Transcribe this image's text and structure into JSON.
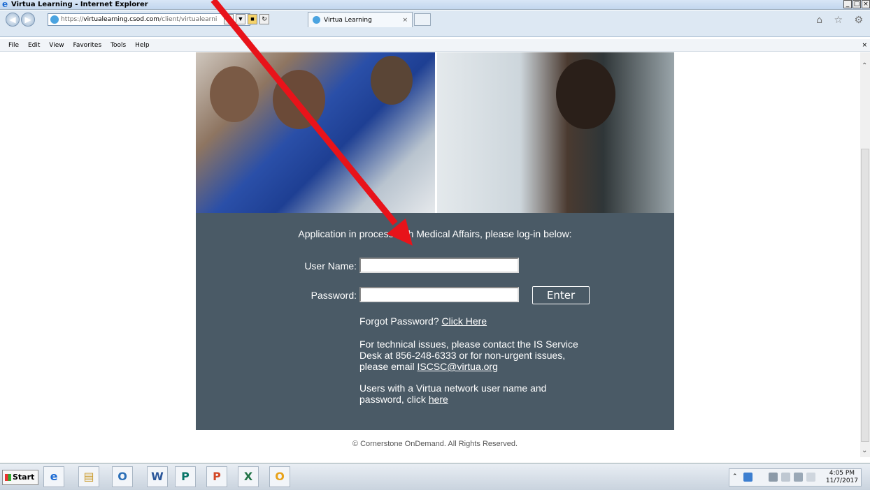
{
  "window": {
    "title": "Virtua Learning - Internet Explorer",
    "controls": [
      "_",
      "□",
      "×"
    ]
  },
  "browser": {
    "url_protocol": "https://",
    "url_host": "virtualearning.csod.com",
    "url_path": "/client/virtualearni",
    "tab_title": "Virtua Learning",
    "tab_close": "×",
    "right_icons": "⌂ ☆ ⚙"
  },
  "menubar": {
    "items": [
      "File",
      "Edit",
      "View",
      "Favorites",
      "Tools",
      "Help"
    ],
    "right": "×"
  },
  "login": {
    "intro": "Application in process with Medical Affairs, please log-in below:",
    "username_label": "User Name:",
    "password_label": "Password:",
    "username_value": "",
    "password_value": "",
    "enter_label": "Enter",
    "forgot_prefix": "Forgot Password?",
    "forgot_link": "Click Here",
    "tech_text": "For technical issues, please contact the IS Service Desk at 856-248-6333 or for non-urgent issues, please email",
    "tech_email": "ISCSC@virtua.org",
    "network_text": "Users with a Virtua network user name and password, click",
    "network_link": "here"
  },
  "footer": {
    "copyright": "© Cornerstone OnDemand. All Rights Reserved."
  },
  "taskbar": {
    "start_label": "Start",
    "apps": [
      "ie-icon",
      "folder-icon",
      "outlook-icon",
      "word-icon",
      "publisher-icon",
      "powerpoint-icon",
      "excel-icon",
      "outlook-calendar-icon"
    ],
    "time": "4:05 PM",
    "date": "11/7/2017"
  },
  "annotation": {
    "arrow_color": "#e8131a"
  }
}
